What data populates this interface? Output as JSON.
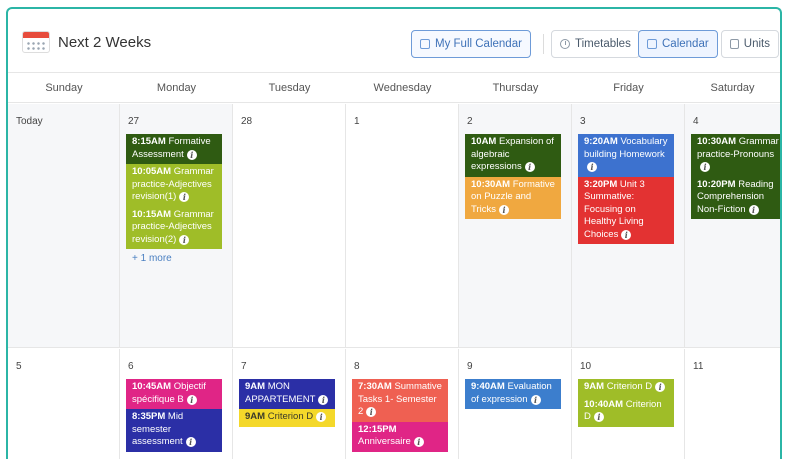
{
  "header": {
    "title": "Next 2 Weeks",
    "buttons": {
      "my_full_calendar": "My Full Calendar",
      "timetables": "Timetables",
      "calendar": "Calendar",
      "units": "Units"
    }
  },
  "day_names": [
    "Sunday",
    "Monday",
    "Tuesday",
    "Wednesday",
    "Thursday",
    "Friday",
    "Saturday"
  ],
  "today_label": "Today",
  "more_label": "+ 1 more",
  "week1": [
    {
      "num": "27",
      "events": [
        {
          "time": "8:15AM",
          "text": "Formative Assessment",
          "color": "darkgreen"
        },
        {
          "time": "10:05AM",
          "text": "Grammar practice-Adjectives revision(1)",
          "color": "lime"
        },
        {
          "time": "10:15AM",
          "text": "Grammar practice-Adjectives revision(2)",
          "color": "lime"
        }
      ]
    },
    {
      "num": "28",
      "events": []
    },
    {
      "num": "1",
      "events": []
    },
    {
      "num": "2",
      "events": [
        {
          "time": "10AM",
          "text": "Expansion of algebraic expressions",
          "color": "darkgreen"
        },
        {
          "time": "10:30AM",
          "text": "Formative on Puzzle and Tricks",
          "color": "orange"
        }
      ]
    },
    {
      "num": "3",
      "events": [
        {
          "time": "9:20AM",
          "text": "Vocabulary building Homework",
          "color": "blue"
        },
        {
          "time": "3:20PM",
          "text": "Unit 3 Summative: Focusing on Healthy Living Choices",
          "color": "red"
        }
      ]
    },
    {
      "num": "4",
      "events": [
        {
          "time": "10:30AM",
          "text": "Grammar practice-Pronouns",
          "color": "darkgreen"
        },
        {
          "time": "10:20PM",
          "text": "Reading Comprehension Non-Fiction",
          "color": "darkgreen"
        }
      ]
    }
  ],
  "week2": [
    {
      "num": "5",
      "events": []
    },
    {
      "num": "6",
      "events": [
        {
          "time": "10:45AM",
          "text": "Objectif spécifique B",
          "color": "magenta"
        },
        {
          "time": "8:35PM",
          "text": "Mid semester assessment",
          "color": "navy"
        }
      ]
    },
    {
      "num": "7",
      "events": [
        {
          "time": "9AM",
          "text": "MON APPARTEMENT",
          "color": "navy"
        },
        {
          "time": "9AM",
          "text": "Criterion D",
          "color": "yellow"
        }
      ]
    },
    {
      "num": "8",
      "events": [
        {
          "time": "7:30AM",
          "text": "Summative Tasks 1- Semester 2",
          "color": "salmon"
        },
        {
          "time": "12:15PM",
          "text": "Anniversaire",
          "color": "magenta"
        }
      ]
    },
    {
      "num": "9",
      "events": [
        {
          "time": "9:40AM",
          "text": "Evaluation of expression",
          "color": "steel"
        }
      ]
    },
    {
      "num": "10",
      "events": [
        {
          "time": "9AM",
          "text": "Criterion D",
          "color": "lime"
        },
        {
          "time": "10:40AM",
          "text": "Criterion D",
          "color": "lime"
        }
      ]
    },
    {
      "num": "11",
      "events": []
    }
  ],
  "colors": {
    "darkgreen": "#2f5b12",
    "lime": "#9fbd28",
    "orange": "#f0a840",
    "blue": "#3d72cf",
    "red": "#e33232",
    "magenta": "#e02586",
    "navy": "#2b2fa6",
    "yellow": "#f4d82a",
    "salmon": "#ef6052",
    "steel": "#3c7ecd",
    "accent": "#2bb5a6"
  }
}
